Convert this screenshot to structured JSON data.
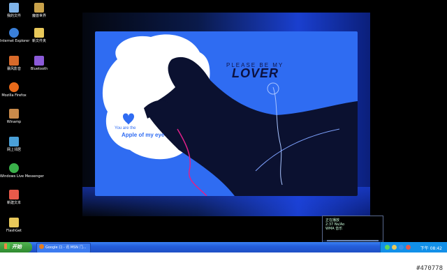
{
  "desktop": {
    "icons": [
      {
        "label": "我的文件",
        "color": "#7fb3e8",
        "icon": "my-documents-icon"
      },
      {
        "label": "魔兽世界",
        "color": "#c9a24a",
        "icon": "game-icon"
      },
      {
        "label": "Internet Explorer",
        "color": "#3a7fd8",
        "icon": "internet-explorer-icon"
      },
      {
        "label": "新文件夹",
        "color": "#e8c85a",
        "icon": "folder-icon"
      },
      {
        "label": "暴风影音",
        "color": "#d86a2a",
        "icon": "media-player-icon"
      },
      {
        "label": "Bluetooth",
        "color": "#8b5ad8",
        "icon": "bluetooth-icon"
      },
      {
        "label": "Mozilla Firefox",
        "color": "#e86a1a",
        "icon": "firefox-icon"
      },
      {
        "label": "Winamp",
        "color": "#c98a4a",
        "icon": "winamp-icon"
      },
      {
        "label": "网上邻居",
        "color": "#4aa0d8",
        "icon": "network-icon"
      },
      {
        "label": "Windows Live Messenger",
        "color": "#3ab04a",
        "icon": "messenger-icon"
      },
      {
        "label": "新建文本",
        "color": "#e85a4a",
        "icon": "document-icon"
      },
      {
        "label": "FlashGet",
        "color": "#e8c85a",
        "icon": "folder-icon"
      }
    ]
  },
  "wallpaper": {
    "please": "PLEASE BE MY",
    "lover": "LOVER",
    "you_are": "You are the",
    "apple": "Apple of my eye"
  },
  "taskbar": {
    "start_label": "开始",
    "task_item_label": "Google 口 - 讯 MSN 门...",
    "clock": "下午 08:42"
  },
  "media_player": {
    "line1": "正在播放",
    "line2": "2:37 Ns/Ao",
    "line3": "WMA 音乐"
  },
  "watermark": "#470778",
  "colors": {
    "accent": "#2f6cf2",
    "taskbar": "#245edb",
    "start": "#3c9a3c"
  }
}
